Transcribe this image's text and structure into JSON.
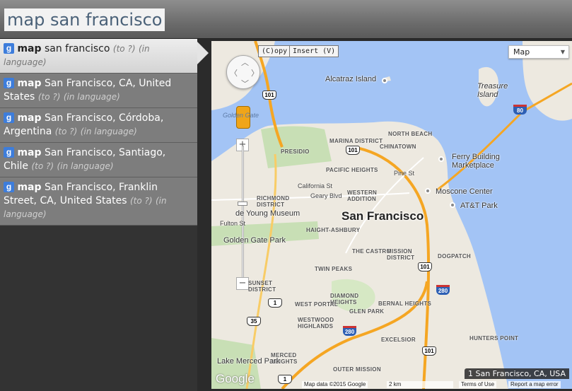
{
  "query": "map san francisco",
  "results": [
    {
      "keyword": "map",
      "text": "san francisco",
      "args": [
        "(to ?)",
        "(in language)"
      ]
    },
    {
      "keyword": "map",
      "text": "San Francisco, CA, United States",
      "args": [
        "(to ?)",
        "(in language)"
      ]
    },
    {
      "keyword": "map",
      "text": "San Francisco, Córdoba, Argentina",
      "args": [
        "(to ?)",
        "(in language)"
      ]
    },
    {
      "keyword": "map",
      "text": "San Francisco, Santiago, Chile",
      "args": [
        "(to ?)",
        "(in language)"
      ]
    },
    {
      "keyword": "map",
      "text": "San Francisco, Franklin Street, CA, United States",
      "args": [
        "(to ?)",
        "(in language)"
      ]
    }
  ],
  "map": {
    "copy_button": "(C)opy",
    "insert_button": "Insert (V)",
    "map_type": "Map",
    "city_label": "San Francisco",
    "result_badge": "1  San Francisco, CA, USA",
    "logo": "Google",
    "footer": {
      "attribution": "Map data ©2015 Google",
      "scale": "2 km",
      "terms": "Terms of Use",
      "report": "Report a map error"
    },
    "labels": {
      "alcatraz": "Alcatraz Island",
      "treasure": "Treasure Island",
      "golden_gate": "Golden Gate",
      "north_beach": "NORTH BEACH",
      "chinatown": "CHINATOWN",
      "marina": "MARINA DISTRICT",
      "presidio": "PRESIDIO",
      "pacific_heights": "PACIFIC HEIGHTS",
      "ferry": "Ferry Building Marketplace",
      "pine": "Pine St",
      "california": "California St",
      "geary": "Geary Blvd",
      "western_addition": "WESTERN ADDITION",
      "richmond": "RICHMOND DISTRICT",
      "moscone": "Moscone Center",
      "att": "AT&T Park",
      "young": "de Young Museum",
      "fulton": "Fulton St",
      "haight": "HAIGHT-ASHBURY",
      "ggpark": "Golden Gate Park",
      "castro": "THE CASTRO",
      "mission": "MISSION DISTRICT",
      "dogpatch": "DOGPATCH",
      "twin_peaks": "TWIN PEAKS",
      "sunset": "SUNSET DISTRICT",
      "diamond": "DIAMOND HEIGHTS",
      "bernal": "BERNAL HEIGHTS",
      "glen_park": "GLEN PARK",
      "west_portal": "WEST PORTAL",
      "west_highlands": "WESTWOOD HIGHLANDS",
      "excelsior": "EXCELSIOR",
      "hunters": "HUNTERS POINT",
      "merced": "MERCED HEIGHTS",
      "outer_mission": "OUTER MISSION",
      "merced_park": "Lake Merced Park"
    }
  }
}
